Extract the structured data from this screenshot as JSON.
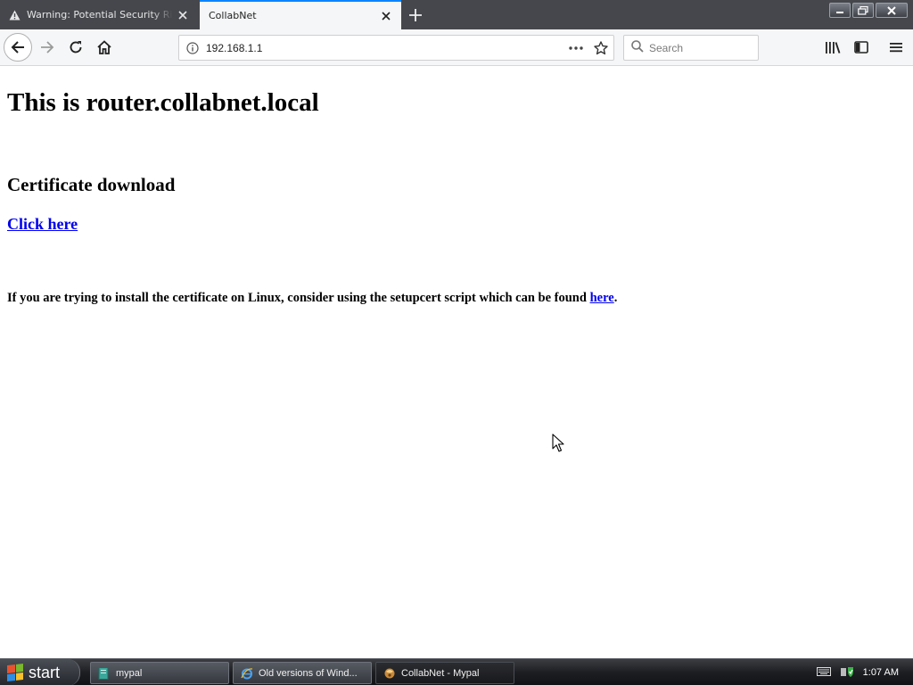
{
  "browser": {
    "tabs": [
      {
        "title": "Warning: Potential Security Risk Ahead",
        "active": false
      },
      {
        "title": "CollabNet",
        "active": true
      }
    ],
    "url": "192.168.1.1",
    "search_placeholder": "Search"
  },
  "page": {
    "heading": "This is router.collabnet.local",
    "subheading": "Certificate download",
    "download_link": "Click here",
    "note_text": "If you are trying to install the certificate on Linux, consider using the setupcert script which can be found ",
    "note_link": "here",
    "note_end": "."
  },
  "taskbar": {
    "start_label": "start",
    "tasks": [
      {
        "label": "mypal"
      },
      {
        "label": "Old versions of Wind..."
      },
      {
        "label": "CollabNet - Mypal"
      }
    ],
    "clock": "1:07 AM"
  },
  "colors": {
    "link": "#0000ee",
    "tab_accent": "#0a84ff",
    "chrome_dark": "#45474c",
    "toolbar": "#f5f6f7"
  }
}
